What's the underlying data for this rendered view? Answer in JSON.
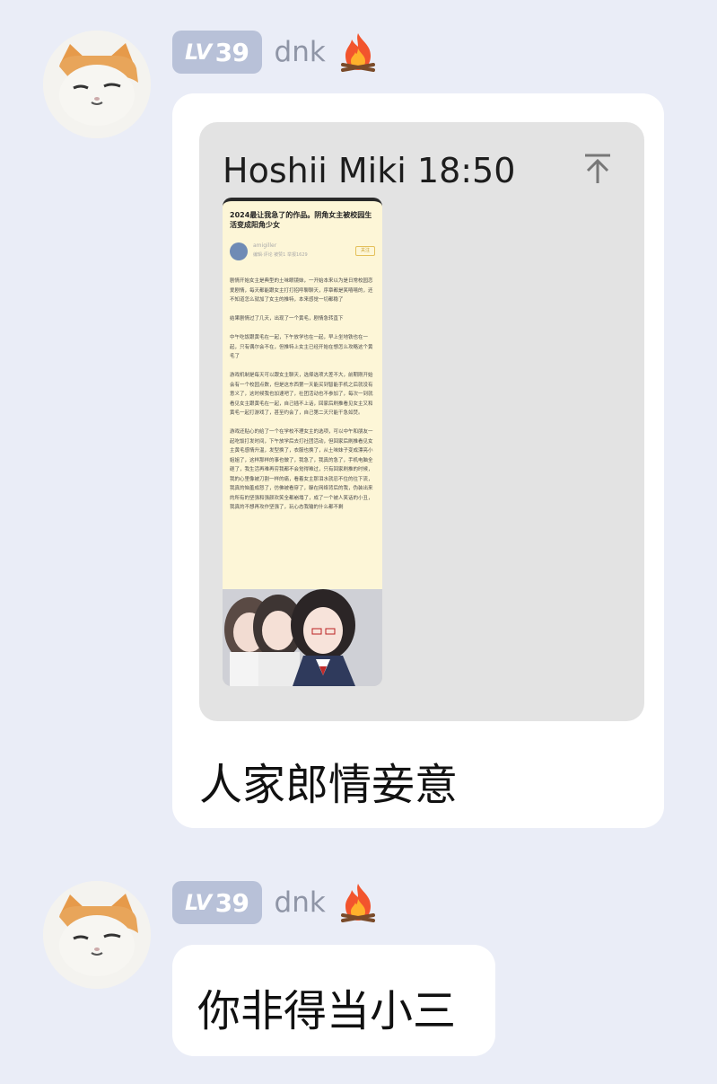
{
  "messages": [
    {
      "user": {
        "level_prefix": "LV",
        "level_number": "39",
        "name": "dnk",
        "flair_icon": "fire-icon"
      },
      "quote": {
        "header": "Hoshii Miki 18:50",
        "scroll_icon": "scroll-to-top-icon",
        "thumb": {
          "title": "2024最让我急了的作品。阴角女主被校园生活变成阳角少女",
          "author_name": "amigiller",
          "author_meta": "编辑·评论 被赞1 举报1629",
          "follow": "关注",
          "body": "剧情开始女主是典型的土味眼镜妹，一开始本来以为是日常校园恋爱剧情，每天都能跟女主打打招呼聊聊天，序章都是笑嘻嘻的，还不知道怎么就加了女主的推特，本来感觉一切都稳了\n\n结果剧情过了几天，出现了一个黄毛，剧情急转直下\n\n中午吃饭跟黄毛在一起，下午放学也在一起，早上坐地铁也在一起，只有偶尔会不在，但推特上女主已经开始在想怎么攻略这个黄毛了\n\n游戏机制是每天可以跟女主聊天，选择选项大差不大，前期刚开始会有一个校园点数，但是这东西第一天能买到智能手机之后就没有意义了，这时候我也加速吧了，社团活动也不参加了，每次一到就看见女主跟黄毛在一起，自己插不上话，回家后刷推看见女主又和黄毛一起打游戏了，甚至约会了，自己第二天只能干急如焚。\n\n游戏还贴心的给了一个在学校不理女主的选项，可以中午和朋友一起吃饭打发时间，下午放学后去打社团活动，但回家后刷推看见女主黄毛感情升温，发型换了，衣服也换了，从土味妹子变成漂亮小姐姐了，这样那样的事也做了，我急了，我真的急了，手机电脑全砸了，我生活再难再穷我都不会觉得难过，只有回家刷推的时候，我的心里像被刀割一样的痛，看着女主那泪水就忍不住的往下流，我真的恼羞成怒了，仿佛被看穿了，躲在网络背后的我，伪装出来的所有的坚强和强颜欢笑全都崩塌了，成了一个被人笑话的小丑，我真的不想再攻作坚强了，玩心态我输的什么都不剩"
        }
      },
      "text": "人家郎情妾意"
    },
    {
      "user": {
        "level_prefix": "LV",
        "level_number": "39",
        "name": "dnk",
        "flair_icon": "fire-icon"
      },
      "text": "你非得当小三"
    }
  ]
}
